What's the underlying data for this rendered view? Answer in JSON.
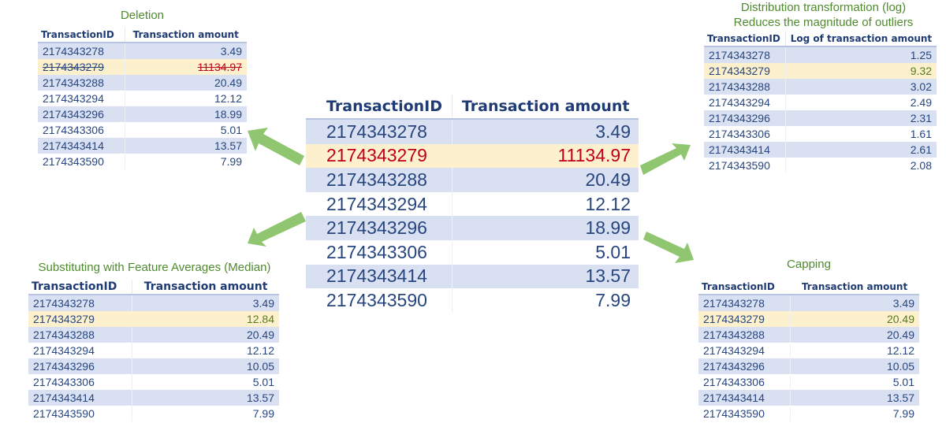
{
  "center": {
    "headers": [
      "TransactionID",
      "Transaction amount"
    ],
    "rows": [
      {
        "id": "2174343278",
        "amount": "3.49"
      },
      {
        "id": "2174343279",
        "amount": "11134.97",
        "outlier": true
      },
      {
        "id": "2174343288",
        "amount": "20.49"
      },
      {
        "id": "2174343294",
        "amount": "12.12"
      },
      {
        "id": "2174343296",
        "amount": "18.99"
      },
      {
        "id": "2174343306",
        "amount": "5.01"
      },
      {
        "id": "2174343414",
        "amount": "13.57"
      },
      {
        "id": "2174343590",
        "amount": "7.99"
      }
    ]
  },
  "deletion": {
    "title": "Deletion",
    "headers": [
      "TransactionID",
      "Transaction amount"
    ],
    "rows": [
      {
        "id": "2174343278",
        "amount": "3.49"
      },
      {
        "id": "2174343279",
        "amount": "11134.97",
        "deleted": true
      },
      {
        "id": "2174343288",
        "amount": "20.49"
      },
      {
        "id": "2174343294",
        "amount": "12.12"
      },
      {
        "id": "2174343296",
        "amount": "18.99"
      },
      {
        "id": "2174343306",
        "amount": "5.01"
      },
      {
        "id": "2174343414",
        "amount": "13.57"
      },
      {
        "id": "2174343590",
        "amount": "7.99"
      }
    ]
  },
  "log_transform": {
    "title_line1": "Distribution transformation (log)",
    "title_line2": "Reduces the magnitude of outliers",
    "headers": [
      "TransactionID",
      "Log of transaction amount"
    ],
    "rows": [
      {
        "id": "2174343278",
        "amount": "1.25"
      },
      {
        "id": "2174343279",
        "amount": "9.32",
        "changed": true
      },
      {
        "id": "2174343288",
        "amount": "3.02"
      },
      {
        "id": "2174343294",
        "amount": "2.49"
      },
      {
        "id": "2174343296",
        "amount": "2.31"
      },
      {
        "id": "2174343306",
        "amount": "1.61"
      },
      {
        "id": "2174343414",
        "amount": "2.61"
      },
      {
        "id": "2174343590",
        "amount": "2.08"
      }
    ]
  },
  "median": {
    "title": "Substituting with Feature Averages (Median)",
    "headers": [
      "TransactionID",
      "Transaction amount"
    ],
    "rows": [
      {
        "id": "2174343278",
        "amount": "3.49"
      },
      {
        "id": "2174343279",
        "amount": "12.84",
        "changed": true
      },
      {
        "id": "2174343288",
        "amount": "20.49"
      },
      {
        "id": "2174343294",
        "amount": "12.12"
      },
      {
        "id": "2174343296",
        "amount": "10.05"
      },
      {
        "id": "2174343306",
        "amount": "5.01"
      },
      {
        "id": "2174343414",
        "amount": "13.57"
      },
      {
        "id": "2174343590",
        "amount": "7.99"
      }
    ]
  },
  "capping": {
    "title": "Capping",
    "headers": [
      "TransactionID",
      "Transaction amount"
    ],
    "rows": [
      {
        "id": "2174343278",
        "amount": "3.49"
      },
      {
        "id": "2174343279",
        "amount": "20.49",
        "changed": true
      },
      {
        "id": "2174343288",
        "amount": "20.49"
      },
      {
        "id": "2174343294",
        "amount": "12.12"
      },
      {
        "id": "2174343296",
        "amount": "10.05"
      },
      {
        "id": "2174343306",
        "amount": "5.01"
      },
      {
        "id": "2174343414",
        "amount": "13.57"
      },
      {
        "id": "2174343590",
        "amount": "7.99"
      }
    ]
  },
  "colors": {
    "title_green": "#4f8a2e",
    "header_blue": "#1f3b73",
    "band_blue": "#d9e0f1",
    "highlight_yellow": "#fdf0cc",
    "outlier_red": "#c0001a",
    "arrow_green": "#8fc66f"
  }
}
